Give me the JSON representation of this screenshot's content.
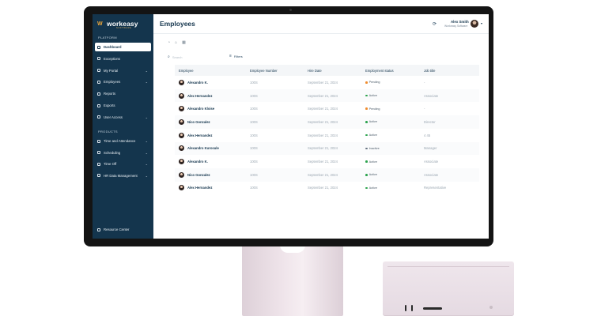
{
  "brand": {
    "name": "workeasy",
    "tagline": "SOFTWARE"
  },
  "sidebar": {
    "platform_label": "PLATFORM",
    "platform_items": [
      {
        "label": "Dashboard",
        "icon": "dashboard-icon",
        "active": true,
        "chevron": false
      },
      {
        "label": "Exceptions",
        "icon": "exceptions-icon",
        "active": false,
        "chevron": false
      },
      {
        "label": "My Portal",
        "icon": "portal-icon",
        "active": false,
        "chevron": true
      },
      {
        "label": "Employees",
        "icon": "employees-icon",
        "active": false,
        "chevron": true
      },
      {
        "label": "Reports",
        "icon": "reports-icon",
        "active": false,
        "chevron": false
      },
      {
        "label": "Exports",
        "icon": "exports-icon",
        "active": false,
        "chevron": false
      },
      {
        "label": "User Access",
        "icon": "user-access-icon",
        "active": false,
        "chevron": true
      }
    ],
    "products_label": "PRODUCTS",
    "product_items": [
      {
        "label": "Time and Attendance",
        "icon": "clock-icon",
        "chevron": true
      },
      {
        "label": "Scheduling",
        "icon": "calendar-icon",
        "chevron": true
      },
      {
        "label": "Time Off",
        "icon": "time-off-icon",
        "chevron": true
      },
      {
        "label": "HR Data Management",
        "icon": "hr-data-icon",
        "chevron": true
      }
    ],
    "resource_center": "Resource Center"
  },
  "header": {
    "title": "Employees",
    "user_name": "Alex Smith",
    "user_company": "Workeasy Software"
  },
  "toolbar": {
    "search_placeholder": "Search",
    "filters_label": "Filters"
  },
  "table": {
    "columns": [
      "Employee",
      "Employee Number",
      "Hire Date",
      "Employment status",
      "Job title"
    ],
    "rows": [
      {
        "name": "Alexandro K.",
        "number": "100S",
        "hire_date": "September 21, 2024",
        "status": "Pending",
        "job": "-"
      },
      {
        "name": "Alex Hernandez",
        "number": "100S",
        "hire_date": "September 21, 2024",
        "status": "Active",
        "job": "Associate"
      },
      {
        "name": "Alexandro Kloise",
        "number": "100S",
        "hire_date": "September 21, 2024",
        "status": "Pending",
        "job": "-"
      },
      {
        "name": "Nico Gonzalez",
        "number": "100S",
        "hire_date": "September 21, 2024",
        "status": "Active",
        "job": "Director"
      },
      {
        "name": "Alex Hernandez",
        "number": "100S",
        "hire_date": "September 21, 2024",
        "status": "Active",
        "job": "4 45"
      },
      {
        "name": "Alexandro Kurosule",
        "number": "100S",
        "hire_date": "September 21, 2024",
        "status": "Inactive",
        "job": "Manager"
      },
      {
        "name": "Alexandro K.",
        "number": "100S",
        "hire_date": "September 21, 2024",
        "status": "Active",
        "job": "Associate"
      },
      {
        "name": "Nico Gonzalez",
        "number": "100S",
        "hire_date": "September 21, 2024",
        "status": "Active",
        "job": "Associate"
      },
      {
        "name": "Alex Hernandez",
        "number": "100S",
        "hire_date": "September 21, 2024",
        "status": "Active",
        "job": "Representative"
      }
    ]
  },
  "colors": {
    "sidebar_bg": "#14354d",
    "accent": "#f2a93b",
    "status_active": "#2ea44f",
    "status_pending": "#f08c2e",
    "status_inactive": "#6b7785"
  }
}
